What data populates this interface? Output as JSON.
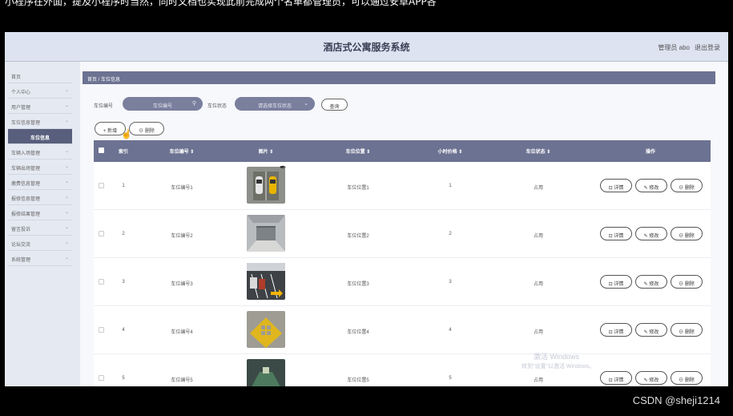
{
  "top_overlay_text": "小程序在外面，提及小程序时当然，同时文档也实现此前完成两个名单都管理员，可以通过安卓APP各",
  "app": {
    "title": "酒店式公寓服务系统",
    "user_label": "管理员 abo",
    "logout_label": "退出登录"
  },
  "sidebar": {
    "items": [
      {
        "label": "首页",
        "chevron": ""
      },
      {
        "label": "个人中心",
        "chevron": "⌄"
      },
      {
        "label": "用户管理",
        "chevron": "⌄"
      },
      {
        "label": "车位信息管理",
        "chevron": "⌄"
      },
      {
        "label": "车位信息",
        "chevron": "",
        "active": true
      },
      {
        "label": "车辆入场管理",
        "chevron": "⌄"
      },
      {
        "label": "车辆出场管理",
        "chevron": "⌄"
      },
      {
        "label": "缴费信息管理",
        "chevron": "⌄"
      },
      {
        "label": "报修信息管理",
        "chevron": "⌄"
      },
      {
        "label": "报修结果管理",
        "chevron": "⌄"
      },
      {
        "label": "留言投诉",
        "chevron": "⌄"
      },
      {
        "label": "论坛交流",
        "chevron": "⌄"
      },
      {
        "label": "系统管理",
        "chevron": "⌄"
      }
    ]
  },
  "breadcrumb": "首页 / 车位信息",
  "search": {
    "field1_label": "车位编号",
    "field1_placeholder": "车位编号",
    "field2_label": "车位状态",
    "field2_placeholder": "请选择车位状态",
    "search_button": "查询",
    "search_icon": "search-icon",
    "dropdown_icon": "chevron-down-icon"
  },
  "actions": {
    "add_label": "+ 新增",
    "delete_label": "⊖ 删除"
  },
  "table": {
    "headers": [
      "索引",
      "车位编号 ⇕",
      "图片 ⇕",
      "车位位置 ⇕",
      "小时价格 ⇕",
      "车位状态 ⇕",
      "操作"
    ],
    "rows": [
      {
        "index": "1",
        "code": "车位编号1",
        "location": "车位位置1",
        "price": "1",
        "status": "占用",
        "thumb": "parking-cars"
      },
      {
        "index": "2",
        "code": "车位编号2",
        "location": "车位位置2",
        "price": "2",
        "status": "占用",
        "thumb": "garage-door"
      },
      {
        "index": "3",
        "code": "车位编号3",
        "location": "车位位置3",
        "price": "3",
        "status": "占用",
        "thumb": "parking-lot"
      },
      {
        "index": "4",
        "code": "车位编号4",
        "location": "车位位置4",
        "price": "4",
        "status": "占用",
        "thumb": "yellow-marking"
      },
      {
        "index": "5",
        "code": "车位编号5",
        "location": "车位位置5",
        "price": "5",
        "status": "占用",
        "thumb": "tunnel"
      }
    ],
    "ops": {
      "detail": "⊡ 详情",
      "edit": "✎ 修改",
      "delete": "⊖ 删除"
    }
  },
  "windows_watermark": {
    "line1": "激活 Windows",
    "line2": "转到\"设置\"以激活 Windows。"
  },
  "credit": "CSDN @sheji1214"
}
